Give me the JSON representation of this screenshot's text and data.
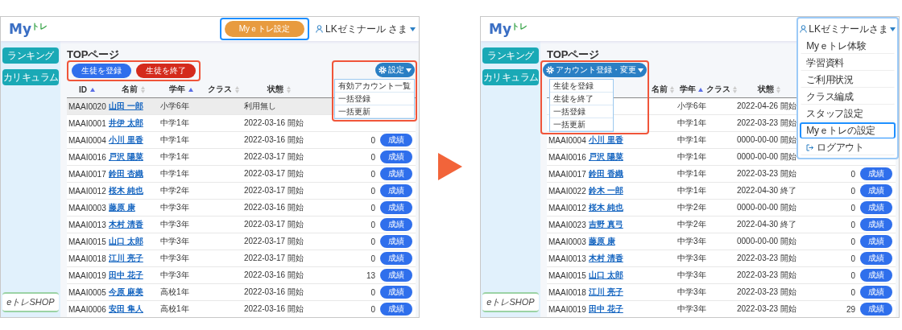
{
  "screens": [
    {
      "logo": {
        "text": "My",
        "sub": "トレ"
      },
      "header_button": {
        "label": "Myｅトレ設定",
        "highlighted": true
      },
      "user": {
        "name": "LKゼミナール さま"
      },
      "sidebar": {
        "items": [
          {
            "label": "ランキング"
          },
          {
            "label": "カリキュラム"
          }
        ]
      },
      "shop_logo": "eトレSHOP",
      "page_title": "TOPページ",
      "action_groups": [
        {
          "kind": "buttons",
          "highlighted": true,
          "buttons": [
            {
              "label": "生徒を登録",
              "color": "#2f6fec"
            },
            {
              "label": "生徒を終了",
              "color": "#d42a1c"
            }
          ]
        },
        {
          "kind": "dropdown",
          "highlighted": true,
          "label": "設定",
          "items": [
            {
              "label": "有効アカウント一覧"
            },
            {
              "label": "一括登録"
            },
            {
              "label": "一括更新"
            }
          ]
        }
      ],
      "table": {
        "columns": [
          {
            "label": "ID",
            "sorted": true
          },
          {
            "label": "名前",
            "sorted": false
          },
          {
            "label": "学年",
            "sorted": true
          },
          {
            "label": "クラス",
            "sorted": false
          },
          {
            "label": "状態",
            "sorted": false
          }
        ],
        "rows": [
          {
            "id": "MAAI0020",
            "name": "山田 一郎",
            "grade": "小学6年",
            "status": "利用無し",
            "selected": true
          },
          {
            "id": "MAAI0001",
            "name": "井伊 太郎",
            "grade": "中学1年",
            "status": "2022-03-16 開始",
            "selected": false
          },
          {
            "id": "MAAI0004",
            "name": "小川 里香",
            "grade": "中学1年",
            "status": "2022-03-16 開始",
            "count": "0",
            "action": "成績",
            "selected": false
          },
          {
            "id": "MAAI0016",
            "name": "戸沢 陽菜",
            "grade": "中学1年",
            "status": "2022-03-17 開始",
            "count": "0",
            "action": "成績",
            "selected": false
          },
          {
            "id": "MAAI0017",
            "name": "鈴田 杏織",
            "grade": "中学1年",
            "status": "2022-03-17 開始",
            "count": "0",
            "action": "成績",
            "selected": false
          },
          {
            "id": "MAAI0012",
            "name": "桜木 純也",
            "grade": "中学2年",
            "status": "2022-03-17 開始",
            "count": "0",
            "action": "成績",
            "selected": false
          },
          {
            "id": "MAAI0003",
            "name": "藤原 康",
            "grade": "中学3年",
            "status": "2022-03-16 開始",
            "count": "0",
            "action": "成績",
            "selected": false
          },
          {
            "id": "MAAI0013",
            "name": "木村 清香",
            "grade": "中学3年",
            "status": "2022-03-17 開始",
            "count": "0",
            "action": "成績",
            "selected": false
          },
          {
            "id": "MAAI0015",
            "name": "山口 太郎",
            "grade": "中学3年",
            "status": "2022-03-17 開始",
            "count": "0",
            "action": "成績",
            "selected": false
          },
          {
            "id": "MAAI0018",
            "name": "江川 亮子",
            "grade": "中学3年",
            "status": "2022-03-17 開始",
            "count": "0",
            "action": "成績",
            "selected": false
          },
          {
            "id": "MAAI0019",
            "name": "田中 花子",
            "grade": "中学3年",
            "status": "2022-03-16 開始",
            "count": "13",
            "action": "成績",
            "selected": false
          },
          {
            "id": "MAAI0005",
            "name": "今原 麻美",
            "grade": "高校1年",
            "status": "2022-03-16 開始",
            "count": "0",
            "action": "成績",
            "selected": false
          },
          {
            "id": "MAAI0006",
            "name": "安田 隼人",
            "grade": "高校1年",
            "status": "2022-03-16 開始",
            "count": "0",
            "action": "成績",
            "selected": false
          }
        ]
      }
    },
    {
      "logo": {
        "text": "My",
        "sub": "トレ"
      },
      "user_menu": {
        "name": "LKゼミナールさま",
        "highlighted": true,
        "items": [
          {
            "label": "Myｅトレ体験",
            "kind": "item",
            "highlighted": false
          },
          {
            "label": "学習資料",
            "kind": "item",
            "highlighted": false
          },
          {
            "label": "ご利用状況",
            "kind": "item",
            "highlighted": false
          },
          {
            "label": "クラス編成",
            "kind": "item",
            "highlighted": false
          },
          {
            "label": "スタッフ設定",
            "kind": "item",
            "highlighted": false
          },
          {
            "label": "Myｅトレの設定",
            "kind": "item",
            "highlighted": true
          },
          {
            "label": "ログアウト",
            "kind": "logout",
            "highlighted": false
          }
        ]
      },
      "sidebar": {
        "items": [
          {
            "label": "ランキング"
          },
          {
            "label": "カリキュラム"
          }
        ]
      },
      "shop_logo": "eトレSHOP",
      "page_title": "TOPページ",
      "action_groups": [
        {
          "kind": "dropdown",
          "highlighted": true,
          "label": "アカウント登録・変更",
          "items": [
            {
              "label": "生徒を登録"
            },
            {
              "label": "生徒を終了"
            },
            {
              "label": "一括登録"
            },
            {
              "label": "一括更新"
            }
          ]
        }
      ],
      "table": {
        "columns": [
          {
            "label": "名前",
            "sorted": false
          },
          {
            "label": "学年",
            "sorted": true
          },
          {
            "label": "クラス",
            "sorted": false
          },
          {
            "label": "状態",
            "sorted": false
          }
        ],
        "rows": [
          {
            "grade": "小学6年",
            "status": "2022-04-26 開始",
            "selected": false
          },
          {
            "grade": "中学1年",
            "status": "2022-03-23 開始",
            "selected": false
          },
          {
            "id": "MAAI0004",
            "name": "小川 里香",
            "grade": "中学1年",
            "status": "0000-00-00 開始",
            "selected": false
          },
          {
            "id": "MAAI0016",
            "name": "戸沢 陽菜",
            "grade": "中学1年",
            "status": "0000-00-00 開始",
            "selected": false
          },
          {
            "id": "MAAI0017",
            "name": "鈴田 香織",
            "grade": "中学1年",
            "status": "2022-03-23 開始",
            "count": "0",
            "action": "成績",
            "selected": false
          },
          {
            "id": "MAAI0022",
            "name": "鈴木 一郎",
            "grade": "中学1年",
            "status": "2022-04-30 終了",
            "count": "0",
            "action": "成績",
            "selected": false
          },
          {
            "id": "MAAI0012",
            "name": "桜木 純也",
            "grade": "中学2年",
            "status": "0000-00-00 開始",
            "count": "0",
            "action": "成績",
            "selected": false
          },
          {
            "id": "MAAI0023",
            "name": "吉野 真弓",
            "grade": "中学2年",
            "status": "2022-04-30 終了",
            "count": "0",
            "action": "成績",
            "selected": false
          },
          {
            "id": "MAAI0003",
            "name": "藤原 康",
            "grade": "中学3年",
            "status": "0000-00-00 開始",
            "count": "0",
            "action": "成績",
            "selected": false
          },
          {
            "id": "MAAI0013",
            "name": "木村 清香",
            "grade": "中学3年",
            "status": "2022-03-23 開始",
            "count": "0",
            "action": "成績",
            "selected": false
          },
          {
            "id": "MAAI0015",
            "name": "山口 太郎",
            "grade": "中学3年",
            "status": "2022-03-23 開始",
            "count": "0",
            "action": "成績",
            "selected": false
          },
          {
            "id": "MAAI0018",
            "name": "江川 亮子",
            "grade": "中学3年",
            "status": "2022-03-23 開始",
            "count": "0",
            "action": "成績",
            "selected": false
          },
          {
            "id": "MAAI0019",
            "name": "田中 花子",
            "grade": "中学3年",
            "status": "2022-03-23 開始",
            "count": "29",
            "action": "成績",
            "selected": false
          }
        ]
      }
    }
  ]
}
